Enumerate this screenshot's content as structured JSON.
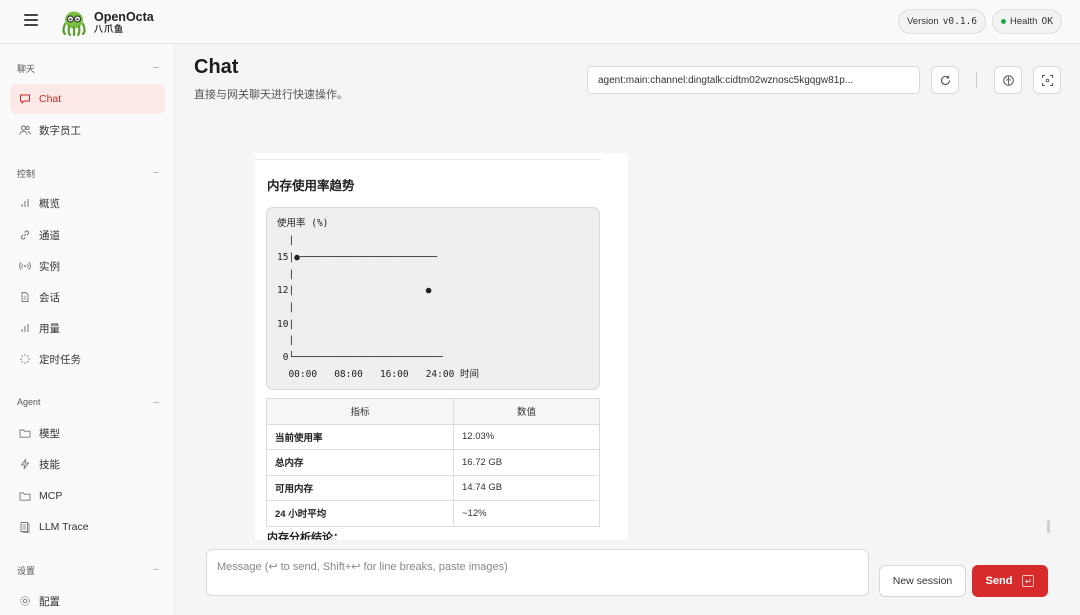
{
  "app": {
    "name": "OpenOcta",
    "name_cn": "八爪鱼"
  },
  "header": {
    "version_label": "Version",
    "version": "v0.1.6",
    "health_label": "Health",
    "health_value": "OK"
  },
  "sidebar": {
    "sections": [
      {
        "title": "聊天",
        "items": [
          {
            "label": "Chat",
            "active": true
          },
          {
            "label": "数字员工"
          }
        ]
      },
      {
        "title": "控制",
        "items": [
          {
            "label": "概览"
          },
          {
            "label": "通道"
          },
          {
            "label": "实例"
          },
          {
            "label": "会话"
          },
          {
            "label": "用量"
          },
          {
            "label": "定时任务"
          }
        ]
      },
      {
        "title": "Agent",
        "items": [
          {
            "label": "模型"
          },
          {
            "label": "技能"
          },
          {
            "label": "MCP"
          },
          {
            "label": "LLM Trace"
          }
        ]
      },
      {
        "title": "设置",
        "items": [
          {
            "label": "配置"
          }
        ]
      }
    ]
  },
  "page": {
    "title": "Chat",
    "subtitle": "直接与网关聊天进行快速操作。",
    "session_key": "agent:main:channel:dingtalk:cidtm02wznosc5kgqgw81p..."
  },
  "message": {
    "heading": "内存使用率趋势",
    "chart_lines": [
      "使用率 (%)",
      "  |",
      "15|●────────────────────────",
      "  |",
      "12|                       ●",
      "  |",
      "10|",
      "  |",
      " 0└──────────────────────────",
      "  00:00   08:00   16:00   24:00 时间"
    ],
    "table": {
      "headers": [
        "指标",
        "数值"
      ],
      "rows": [
        [
          "当前使用率",
          "12.03%"
        ],
        [
          "总内存",
          "16.72 GB"
        ],
        [
          "可用内存",
          "14.74 GB"
        ],
        [
          "24 小时平均",
          "~12%"
        ]
      ]
    },
    "conclusion": "内存分析结论："
  },
  "composer": {
    "placeholder": "Message (↩ to send, Shift+↩ for line breaks, paste images)",
    "new_session": "New session",
    "send": "Send",
    "send_key": "↵"
  }
}
